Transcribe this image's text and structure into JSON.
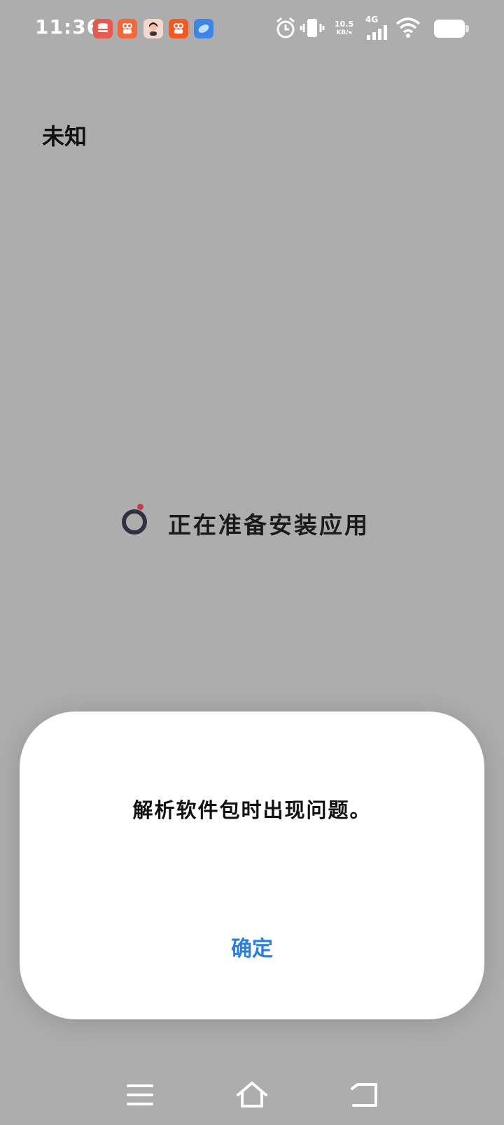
{
  "status_bar": {
    "time": "11:36",
    "net_speed_value": "10.5",
    "net_speed_unit": "KB/s",
    "network_type": "4G",
    "app_icons": [
      {
        "name": "app-notification-icon-1",
        "color": "#e85a4f"
      },
      {
        "name": "app-notification-icon-2",
        "color": "#f2683a"
      },
      {
        "name": "avatar-notification-icon",
        "color": "#f4d7cf"
      },
      {
        "name": "app-notification-icon-3",
        "color": "#f25a1f"
      },
      {
        "name": "app-notification-icon-4",
        "color": "#3d86e8"
      }
    ]
  },
  "page": {
    "title": "未知",
    "progress_text": "正在准备安装应用"
  },
  "dialog": {
    "message": "解析软件包时出现问题。",
    "confirm_label": "确定"
  },
  "colors": {
    "background": "#adadad",
    "accent": "#2a7fe0",
    "spinner": "#303040",
    "spinner_dot": "#c2404a"
  },
  "nav_bar": {
    "icons": [
      "menu-icon",
      "home-icon",
      "back-icon"
    ]
  }
}
